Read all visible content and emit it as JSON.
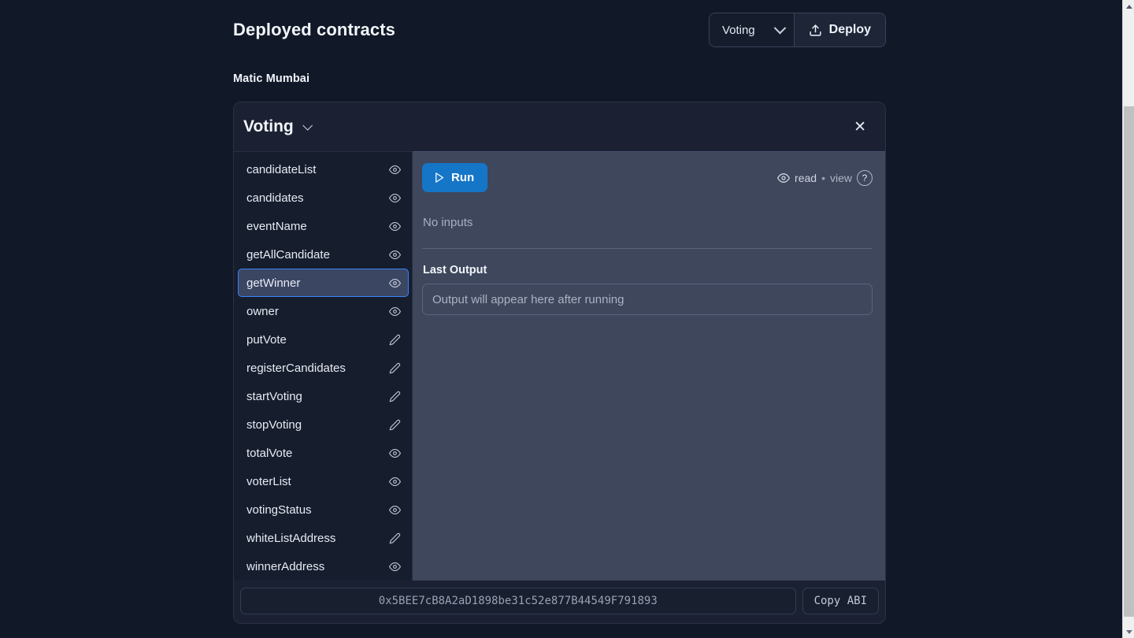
{
  "header": {
    "title": "Deployed contracts",
    "chain_select": {
      "value": "Voting",
      "chevron_icon": "chevron-down-icon"
    },
    "deploy_button": {
      "label": "Deploy",
      "icon": "upload-icon"
    }
  },
  "network": {
    "label": "Matic Mumbai"
  },
  "card": {
    "title": "Voting",
    "collapse_icon": "chevron-down-icon",
    "close_icon": "close-icon",
    "functions": [
      {
        "name": "candidateList",
        "kind_icon": "eye-icon",
        "selected": false
      },
      {
        "name": "candidates",
        "kind_icon": "eye-icon",
        "selected": false
      },
      {
        "name": "eventName",
        "kind_icon": "eye-icon",
        "selected": false
      },
      {
        "name": "getAllCandidate",
        "kind_icon": "eye-icon",
        "selected": false
      },
      {
        "name": "getWinner",
        "kind_icon": "eye-icon",
        "selected": true
      },
      {
        "name": "owner",
        "kind_icon": "eye-icon",
        "selected": false
      },
      {
        "name": "putVote",
        "kind_icon": "pencil-icon",
        "selected": false
      },
      {
        "name": "registerCandidates",
        "kind_icon": "pencil-icon",
        "selected": false
      },
      {
        "name": "startVoting",
        "kind_icon": "pencil-icon",
        "selected": false
      },
      {
        "name": "stopVoting",
        "kind_icon": "pencil-icon",
        "selected": false
      },
      {
        "name": "totalVote",
        "kind_icon": "eye-icon",
        "selected": false
      },
      {
        "name": "voterList",
        "kind_icon": "eye-icon",
        "selected": false
      },
      {
        "name": "votingStatus",
        "kind_icon": "eye-icon",
        "selected": false
      },
      {
        "name": "whiteListAddress",
        "kind_icon": "pencil-icon",
        "selected": false
      },
      {
        "name": "winnerAddress",
        "kind_icon": "eye-icon",
        "selected": false
      }
    ],
    "detail": {
      "run_button": {
        "label": "Run",
        "icon": "play-icon"
      },
      "mutability": {
        "icon": "eye-icon",
        "access": "read",
        "separator": "•",
        "state": "view",
        "help": "?"
      },
      "inputs_empty_text": "No inputs",
      "output_label": "Last Output",
      "output_placeholder": "Output will appear here after running"
    },
    "footer": {
      "address": "0x5BEE7cB8A2aD1898be31c52e877B44549F791893",
      "copy_abi_label": "Copy ABI"
    }
  },
  "colors": {
    "page_bg": "#111827",
    "card_bg": "#1b2133",
    "list_bg": "#161d2d",
    "detail_bg": "#3e475c",
    "accent_blue": "#1576c8",
    "selected_border": "#3b82f6",
    "selected_bg": "#3b4663"
  },
  "scrollbar": {
    "up_icon": "scroll-up-arrow-icon",
    "down_icon": "scroll-down-arrow-icon"
  }
}
